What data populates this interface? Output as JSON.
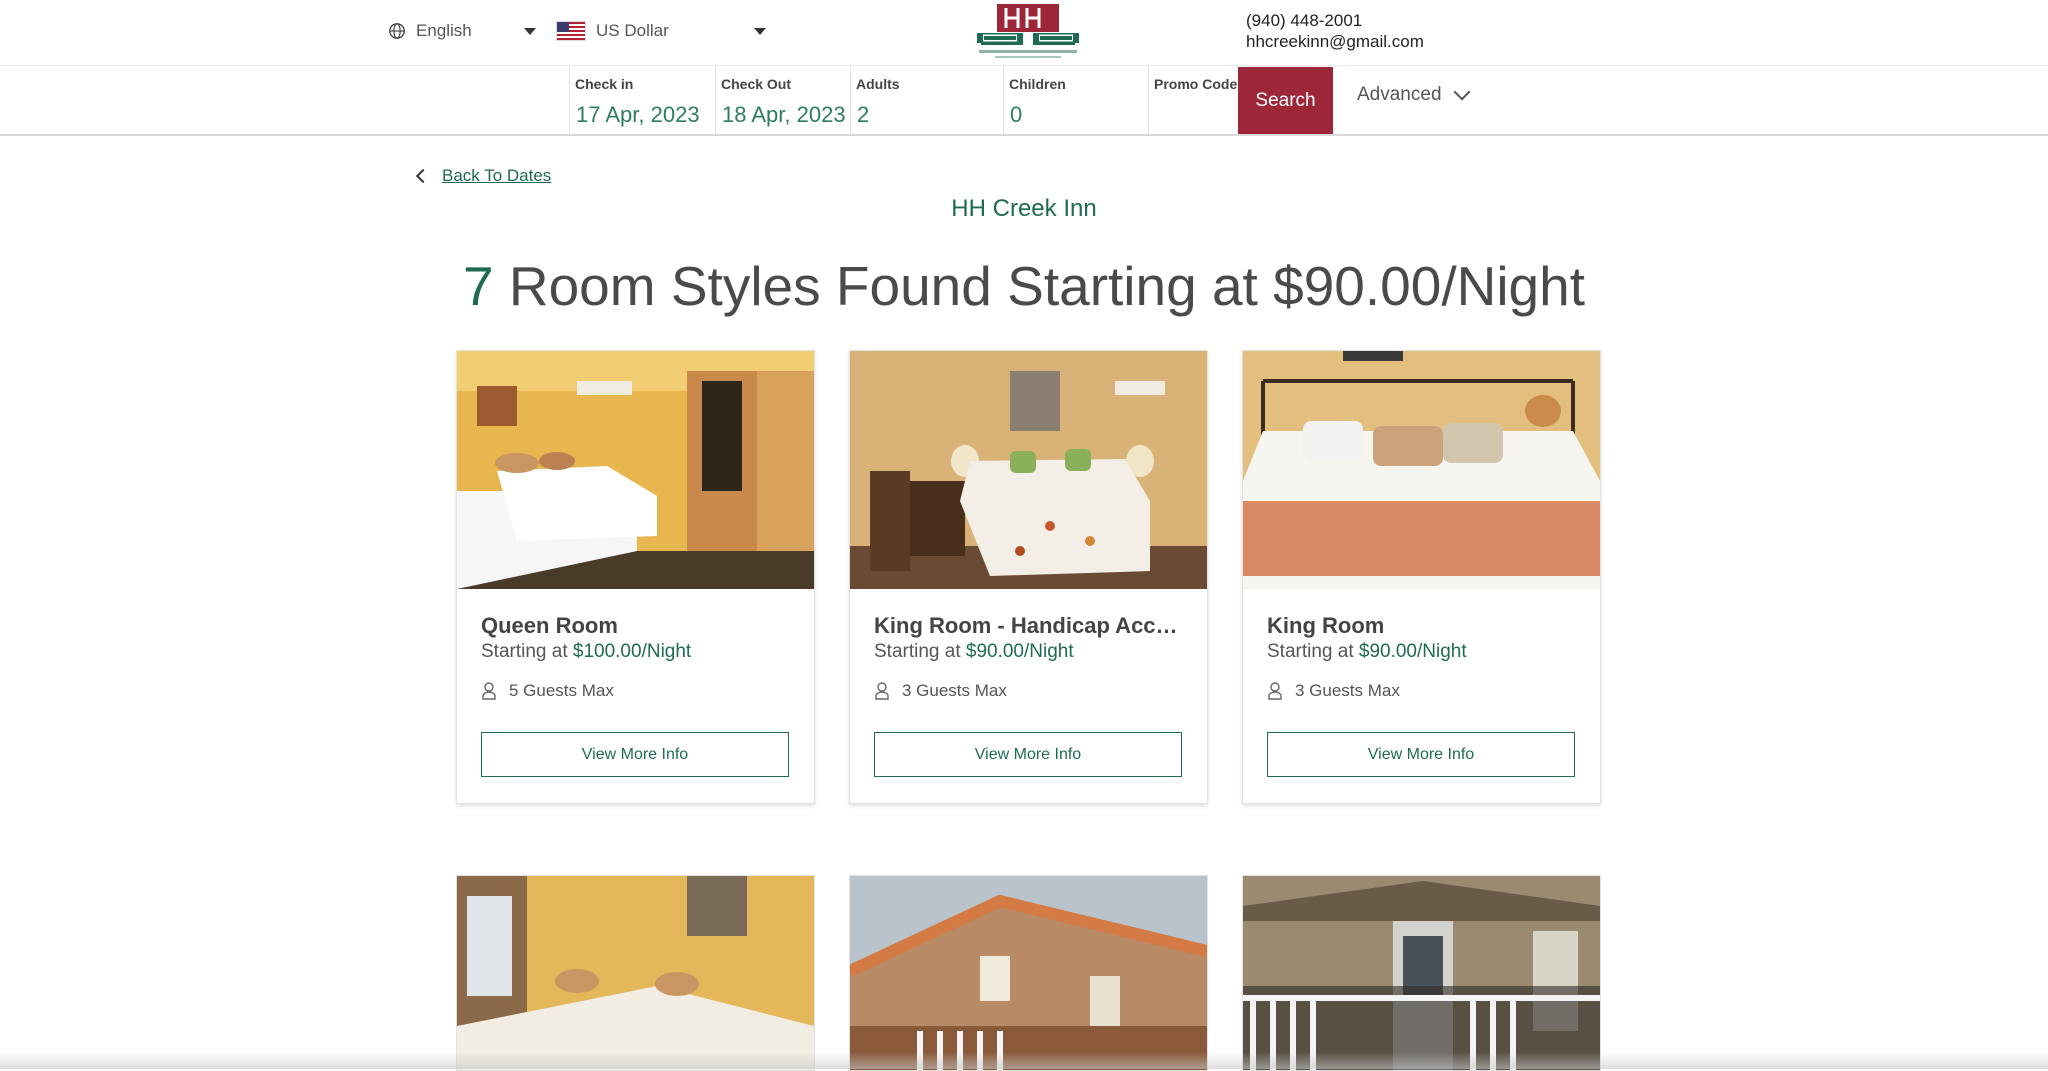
{
  "header": {
    "language": "English",
    "currency": "US Dollar",
    "phone": "(940) 448-2001",
    "email": "hhcreekinn@gmail.com"
  },
  "search": {
    "checkin_label": "Check in",
    "checkin_value": "17 Apr, 2023",
    "checkout_label": "Check Out",
    "checkout_value": "18 Apr, 2023",
    "adults_label": "Adults",
    "adults_value": "2",
    "children_label": "Children",
    "children_value": "0",
    "promo_label": "Promo Code",
    "search_label": "Search",
    "advanced_label": "Advanced"
  },
  "main": {
    "back_label": "Back To Dates",
    "hotel_name": "HH Creek Inn",
    "count": "7",
    "headline_rest": "Room Styles Found Starting at $90.00/Night"
  },
  "rooms": [
    {
      "name": "Queen Room",
      "starting_label": "Starting at",
      "price": "$100.00/Night",
      "guests": "5 Guests Max",
      "button": "View More Info"
    },
    {
      "name": "King Room - Handicap Accessible",
      "starting_label": "Starting at",
      "price": "$90.00/Night",
      "guests": "3 Guests Max",
      "button": "View More Info"
    },
    {
      "name": "King Room",
      "starting_label": "Starting at",
      "price": "$90.00/Night",
      "guests": "3 Guests Max",
      "button": "View More Info"
    }
  ],
  "colors": {
    "brand_green": "#1f6b52",
    "brand_red": "#9e2639"
  }
}
